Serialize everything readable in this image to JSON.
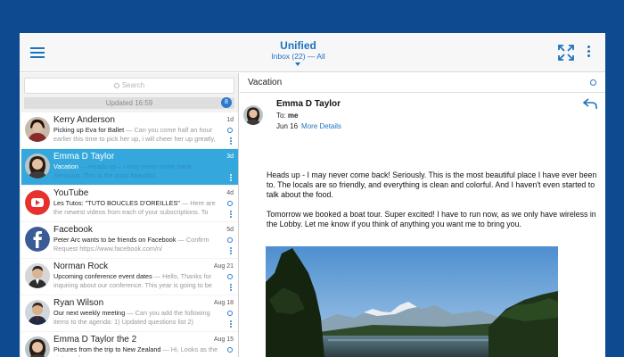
{
  "header": {
    "title": "Unified",
    "subtitle": "Inbox (22) — All"
  },
  "list": {
    "search_placeholder": "Search",
    "updated": "Updated 16:59",
    "unread_count": "8",
    "messages": [
      {
        "sender": "Kerry Anderson",
        "subject": "Picking up Eva for Ballet",
        "snippet": " — Can you come half an hour earlier this time to pick her up, i will cheer her up greatly,",
        "date": "1d"
      },
      {
        "sender": "Emma D Taylor",
        "subject": "Vacation",
        "snippet": " — Heads up – I may never come back! Seriously. This is the most beautiful",
        "date": "3d"
      },
      {
        "sender": "YouTube",
        "subject": "Les Tutos: \"TUTO BOUCLES D'OREILLES\"",
        "snippet": " — Here are the newest videos from each of your subscriptions. To",
        "date": "4d"
      },
      {
        "sender": "Facebook",
        "subject": "Peter Arc wants to be friends on Facebook",
        "snippet": " — Confirm Request https://www.facebook.com/n/",
        "date": "5d"
      },
      {
        "sender": "Norman Rock",
        "subject": "Upcoming conference event dates",
        "snippet": " — Hello, Thanks for inquiring about our conference. This year is going to be",
        "date": "Aug 21"
      },
      {
        "sender": "Ryan Wilson",
        "subject": "Our next weekly meeting",
        "snippet": " — Can you add the following items to the agenda: 1) Updated questions list 2)",
        "date": "Aug 18"
      },
      {
        "sender": "Emma D Taylor the 2",
        "subject": "Pictures from the trip to New Zealand",
        "snippet": " — Hi, Looks as the pictures from",
        "date": "Aug 15"
      }
    ]
  },
  "reader": {
    "subject": "Vacation",
    "from": "Emma D Taylor",
    "to_label": "To:",
    "to_value": "me",
    "date": "Jun 16",
    "more_details": "More Details",
    "body": [
      "Heads up - I may never come back! Seriously. This is the most beautiful place I have ever been to. The locals are so friendly, and everything is clean and colorful. And I haven't even started to talk about the food.",
      "Tomorrow we booked a boat tour. Super excited! I have to run now, as we only have wireless in the Lobby. Let me know if you think of anything you want me to bring you."
    ]
  },
  "colors": {
    "background": "#0d4a8f",
    "accent": "#1e73be",
    "selected_row": "#34a8dd",
    "youtube": "#e6312d",
    "facebook": "#3b5b98"
  }
}
